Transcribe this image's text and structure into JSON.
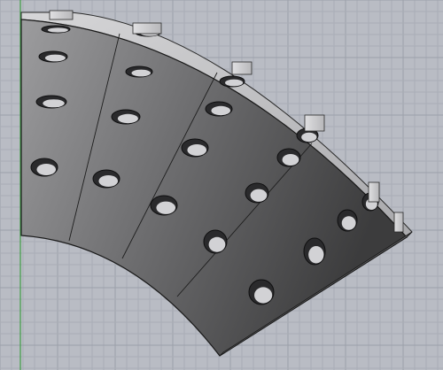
{
  "viewport": {
    "view": "perspective",
    "background_color": "#b9bcc4",
    "grid": {
      "visible": true,
      "minor_line_color": "#a9adb6",
      "major_line_color": "#9ca0aa",
      "y_axis_color": "#3f9e46"
    }
  },
  "part": {
    "shape": "curved perforated plate",
    "face_color_light": "#9c9c9e",
    "face_color_dark": "#3c3c3d",
    "edge_color": "#1a1a1a",
    "rim_color": "#c9c9cb",
    "segment_count": 4,
    "hole_rows": 4,
    "holes_per_row": 5,
    "tab_count": 6
  }
}
